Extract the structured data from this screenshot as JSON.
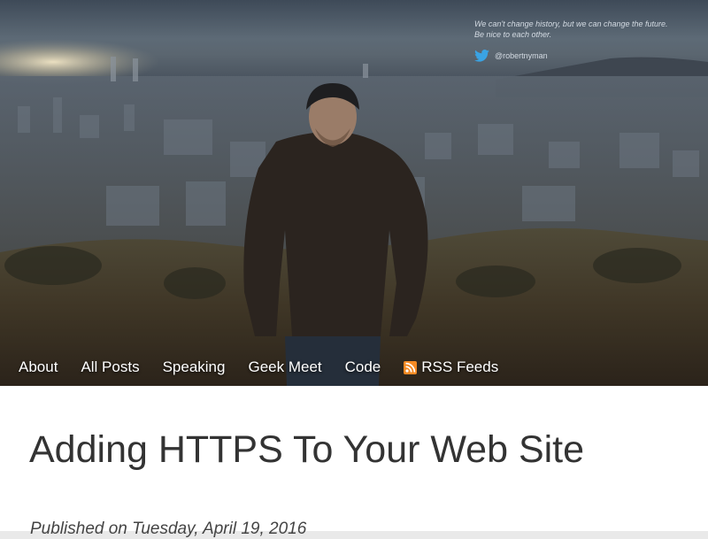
{
  "header": {
    "tagline_line1": "We can't change history, but we can change the future.",
    "tagline_line2": "Be nice to each other.",
    "twitter_handle": "@robertnyman",
    "twitter_color": "#3aa3e3"
  },
  "nav": {
    "items": [
      {
        "label": "About"
      },
      {
        "label": "All Posts"
      },
      {
        "label": "Speaking"
      },
      {
        "label": "Geek Meet"
      },
      {
        "label": "Code"
      },
      {
        "label": "RSS Feeds",
        "icon": "rss-icon"
      }
    ],
    "rss_color": "#f58a23"
  },
  "article": {
    "title": "Adding HTTPS To Your Web Site",
    "published": "Published on Tuesday, April 19, 2016"
  }
}
